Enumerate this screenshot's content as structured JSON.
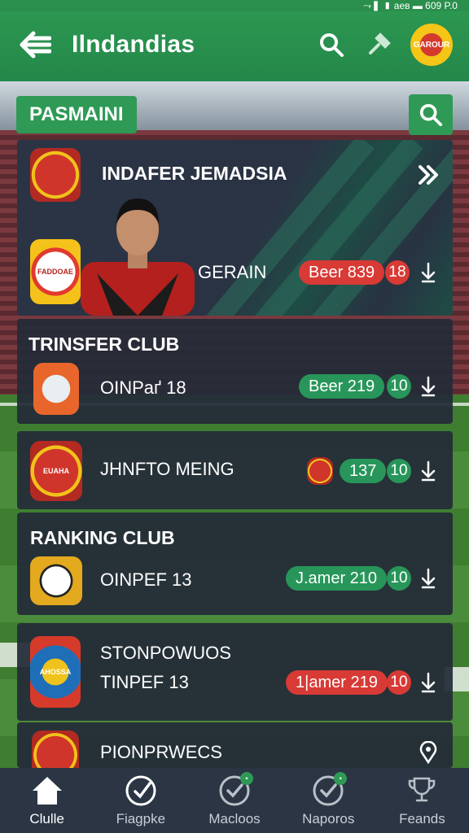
{
  "status": {
    "text": "⤳ ▍▮ аев ▬ 609 P.0"
  },
  "appbar": {
    "title": "Ilndandias",
    "club_logo_text": "GAROUR"
  },
  "search": {
    "chip_label": "PASMAINI"
  },
  "featured": {
    "title": "INDAFER JEMADSIA",
    "crest_top_text": "",
    "crest_bottom_text": "FADDOAE",
    "player_name": "GERAIN",
    "badge": "Beer 839",
    "count": "18"
  },
  "cards": [
    {
      "header": "TRINSFER CLUB",
      "name": "OINPаґ 18",
      "badge": "Beer 219",
      "count": "10",
      "badge_color": "green"
    },
    {
      "header": "",
      "name": "JHNFTO MEING",
      "badge": "137",
      "count": "10",
      "badge_color": "green"
    },
    {
      "header": "RANKING CLUB",
      "name": "OINPEF 13",
      "badge": "J.amer 210",
      "count": "10",
      "badge_color": "green"
    },
    {
      "header": "",
      "name": "STONPOWUOS",
      "name2": "TINPEF 13",
      "badge": "1|amer 219",
      "count": "10",
      "badge_color": "red"
    },
    {
      "header": "",
      "name": "PIONPRWECS",
      "badge": "",
      "count": ""
    }
  ],
  "crest_labels": {
    "card2": "EUAHA",
    "card5": "AHOSSA"
  },
  "bottom_nav": [
    {
      "label": "Clulle",
      "icon": "home-icon",
      "active": true
    },
    {
      "label": "Fiagpke",
      "icon": "soccer-ball-icon",
      "active": false
    },
    {
      "label": "Macloos",
      "icon": "check-circle-icon",
      "active": false
    },
    {
      "label": "Naporos",
      "icon": "check-circle-icon",
      "active": false
    },
    {
      "label": "Feands",
      "icon": "trophy-icon",
      "active": false
    }
  ],
  "colors": {
    "primary": "#2d9a51",
    "card": "#232b38",
    "badge_red": "#d83a35",
    "badge_green": "#28965a"
  }
}
